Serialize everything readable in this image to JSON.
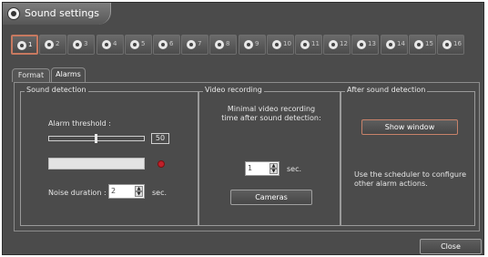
{
  "window": {
    "title": "Sound settings"
  },
  "cameras": [
    {
      "label": "1",
      "active": true
    },
    {
      "label": "2",
      "active": false
    },
    {
      "label": "3",
      "active": false
    },
    {
      "label": "4",
      "active": false
    },
    {
      "label": "5",
      "active": false
    },
    {
      "label": "6",
      "active": false
    },
    {
      "label": "7",
      "active": false
    },
    {
      "label": "8",
      "active": false
    },
    {
      "label": "9",
      "active": false
    },
    {
      "label": "10",
      "active": false
    },
    {
      "label": "11",
      "active": false
    },
    {
      "label": "12",
      "active": false
    },
    {
      "label": "13",
      "active": false
    },
    {
      "label": "14",
      "active": false
    },
    {
      "label": "15",
      "active": false
    },
    {
      "label": "16",
      "active": false
    }
  ],
  "tabs": {
    "format": "Format",
    "alarms": "Alarms",
    "active": "alarms"
  },
  "sound_detection": {
    "legend": "Sound detection",
    "threshold_label": "Alarm threshold :",
    "threshold_value": "50",
    "threshold_fraction": 0.5,
    "noise_label": "Noise duration :",
    "noise_value": "2",
    "noise_unit": "sec."
  },
  "video_recording": {
    "legend": "Video recording",
    "description": "Minimal video recording time after sound detection:",
    "value": "1",
    "unit": "sec.",
    "cameras_button": "Cameras"
  },
  "after_detection": {
    "legend": "After sound detection",
    "show_window_button": "Show window",
    "note": "Use the scheduler to configure other alarm actions."
  },
  "footer": {
    "close_button": "Close"
  },
  "colors": {
    "background": "#4b4b4b",
    "accent_border": "#c77960",
    "recording_dot": "#c0202a"
  }
}
